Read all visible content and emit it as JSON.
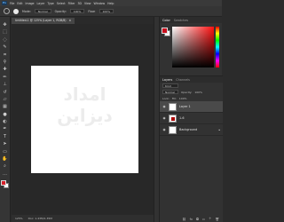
{
  "menubar": {
    "logo": "Ps",
    "items": [
      "File",
      "Edit",
      "Image",
      "Layer",
      "Type",
      "Select",
      "Filter",
      "3D",
      "View",
      "Window",
      "Help"
    ]
  },
  "options": {
    "mode_label": "Mode:",
    "mode_value": "Normal",
    "opacity_label": "Opacity:",
    "opacity_value": "100%",
    "flow_label": "Flow:",
    "flow_value": "100%"
  },
  "document": {
    "tab_title": "Untitled-1 @ 125% (Layer 1, RGB/8)",
    "close_glyph": "×",
    "watermark_line1": "امداد",
    "watermark_line2": "دیزاین"
  },
  "status": {
    "zoom": "125%",
    "doc_size": "Doc: 1.43M/1.35M"
  },
  "colors": {
    "foreground": "#c8101e",
    "background": "#ffffff"
  },
  "panels": {
    "color_tab": "Color",
    "swatches_tab": "Swatches",
    "layers_tab": "Layers",
    "channels_tab": "Channels",
    "kind_label": "Kind",
    "blend_mode": "Normal",
    "opacity_label": "Opacity:",
    "opacity_value": "100%",
    "lock_label": "Lock:",
    "fill_label": "Fill:",
    "fill_value": "100%"
  },
  "layers": [
    {
      "name": "Layer 1",
      "visible": true,
      "selected": true
    },
    {
      "name": "1-6",
      "visible": true,
      "selected": false
    },
    {
      "name": "Background",
      "visible": true,
      "selected": false,
      "locked": true
    }
  ],
  "tools": [
    "move-icon",
    "marquee-icon",
    "lasso-icon",
    "quick-select-icon",
    "crop-icon",
    "eyedropper-icon",
    "healing-icon",
    "brush-icon",
    "clone-stamp-icon",
    "history-brush-icon",
    "eraser-icon",
    "gradient-icon",
    "blur-icon",
    "dodge-icon",
    "pen-icon",
    "type-icon",
    "path-select-icon",
    "shape-icon",
    "hand-icon",
    "zoom-icon",
    "more-icon"
  ]
}
